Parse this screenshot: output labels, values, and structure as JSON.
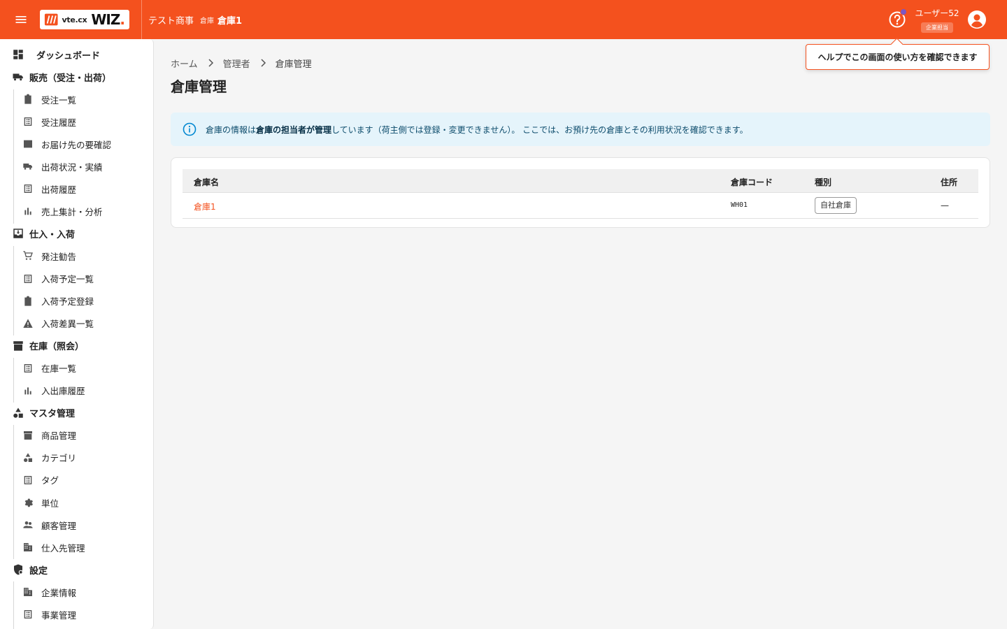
{
  "header": {
    "brand_small": "vte.cx",
    "brand_large": "WIZ",
    "brand_dot": ".",
    "company": "テスト商事",
    "warehouse_label": "倉庫",
    "warehouse_name": "倉庫1",
    "user_name": "ユーザー52",
    "user_role": "企業担当",
    "accent_color": "#f4511e"
  },
  "tooltip": {
    "text": "ヘルプでこの画面の使い方を確認できます"
  },
  "sidebar": {
    "items": [
      {
        "label": "ダッシュボード",
        "icon": "dashboard-icon",
        "section": true
      },
      {
        "label": "販売（受注・出荷）",
        "icon": "truck-icon",
        "section": true
      },
      {
        "label": "受注一覧",
        "icon": "clipboard-icon",
        "section": false
      },
      {
        "label": "受注履歴",
        "icon": "list-icon",
        "section": false
      },
      {
        "label": "お届け先の要確認",
        "icon": "checklist-icon",
        "section": false
      },
      {
        "label": "出荷状況・実績",
        "icon": "truck-icon",
        "section": false
      },
      {
        "label": "出荷履歴",
        "icon": "list-icon",
        "section": false
      },
      {
        "label": "売上集計・分析",
        "icon": "bar-chart-icon",
        "section": false
      },
      {
        "label": "仕入・入荷",
        "icon": "inbox-icon",
        "section": true
      },
      {
        "label": "発注勧告",
        "icon": "cart-icon",
        "section": false
      },
      {
        "label": "入荷予定一覧",
        "icon": "list-icon",
        "section": false
      },
      {
        "label": "入荷予定登録",
        "icon": "clipboard-icon",
        "section": false
      },
      {
        "label": "入荷差異一覧",
        "icon": "warning-icon",
        "section": false
      },
      {
        "label": "在庫（照会）",
        "icon": "archive-icon",
        "section": true
      },
      {
        "label": "在庫一覧",
        "icon": "list-icon",
        "section": false
      },
      {
        "label": "入出庫履歴",
        "icon": "bar-chart-icon",
        "section": false
      },
      {
        "label": "マスタ管理",
        "icon": "shapes-icon",
        "section": true
      },
      {
        "label": "商品管理",
        "icon": "archive-icon",
        "section": false
      },
      {
        "label": "カテゴリ",
        "icon": "shapes-icon",
        "section": false
      },
      {
        "label": "タグ",
        "icon": "list-icon",
        "section": false
      },
      {
        "label": "単位",
        "icon": "gear-icon",
        "section": false
      },
      {
        "label": "顧客管理",
        "icon": "people-icon",
        "section": false
      },
      {
        "label": "仕入先管理",
        "icon": "building-icon",
        "section": false
      },
      {
        "label": "設定",
        "icon": "admin-shield-icon",
        "section": true
      },
      {
        "label": "企業情報",
        "icon": "building-icon",
        "section": false
      },
      {
        "label": "事業管理",
        "icon": "list-icon",
        "section": false
      }
    ]
  },
  "breadcrumb": [
    "ホーム",
    "管理者",
    "倉庫管理"
  ],
  "page_title": "倉庫管理",
  "info": {
    "text_before": "倉庫の情報は",
    "text_bold": "倉庫の担当者が管理",
    "text_after": "しています（荷主側では登録・変更できません）。 ここでは、お預け先の倉庫とその利用状況を確認できます。",
    "color": "#e5f4fb"
  },
  "table": {
    "headers": [
      "倉庫名",
      "倉庫コード",
      "種別",
      "住所"
    ],
    "rows": [
      {
        "name": "倉庫1",
        "code": "WH01",
        "type": "自社倉庫",
        "address": "—"
      }
    ]
  }
}
